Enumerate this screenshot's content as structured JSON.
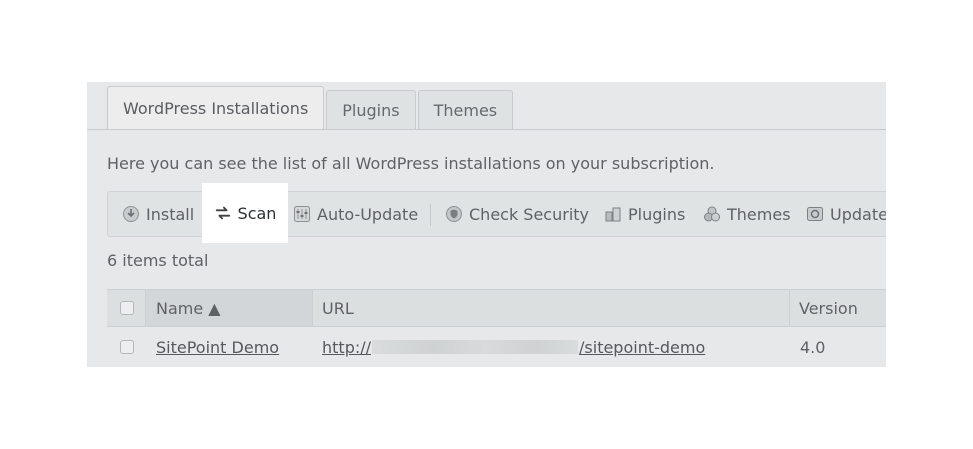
{
  "tabs": [
    "WordPress Installations",
    "Plugins",
    "Themes"
  ],
  "description": "Here you can see the list of all WordPress installations on your subscription.",
  "toolbar": {
    "install": "Install",
    "scan": "Scan",
    "auto_update": "Auto-Update",
    "check_security": "Check Security",
    "plugins": "Plugins",
    "themes": "Themes",
    "update": "Update"
  },
  "items_total": "6 items total",
  "table": {
    "columns": [
      "Name ▲",
      "URL",
      "Version"
    ],
    "rows": [
      {
        "name": "SitePoint Demo",
        "url_prefix": "http://",
        "url_suffix": "/sitepoint-demo",
        "version": "4.0"
      }
    ]
  }
}
